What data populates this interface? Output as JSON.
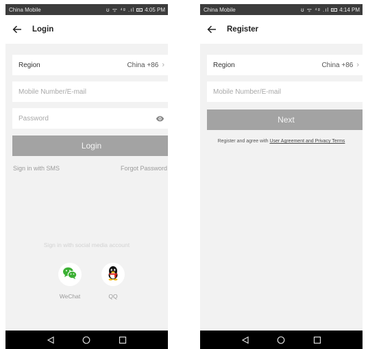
{
  "login": {
    "status": {
      "carrier": "China Mobile",
      "icons": "ʊ ᯤ ⁴ᵍ .ıl",
      "time": "4:05 PM"
    },
    "title": "Login",
    "region": {
      "label": "Region",
      "value": "China +86"
    },
    "account_placeholder": "Mobile Number/E-mail",
    "password_placeholder": "Password",
    "login_button": "Login",
    "sms_link": "Sign in with SMS",
    "forgot_link": "Forgot Password",
    "social": {
      "title": "Sign in with social media account",
      "wechat_label": "WeChat",
      "qq_label": "QQ"
    }
  },
  "register": {
    "status": {
      "carrier": "China Mobile",
      "icons": "ʊ ᯤ ⁴ᵍ .ıl",
      "time": "4:14 PM"
    },
    "title": "Register",
    "region": {
      "label": "Region",
      "value": "China +86"
    },
    "account_placeholder": "Mobile Number/E-mail",
    "next_button": "Next",
    "terms_prefix": "Register and agree with ",
    "terms_link": "User Agreement and Privacy Terms"
  },
  "colors": {
    "button_disabled": "#a3a3a3",
    "background": "#f2f2f2",
    "wechat": "#3cb034",
    "nav_bar": "#000000"
  },
  "icons": {
    "back": "arrow-left-icon",
    "chevron": "chevron-right-icon",
    "eye": "eye-icon",
    "wechat": "wechat-icon",
    "qq": "qq-penguin-icon",
    "nav": [
      "nav-back-icon",
      "nav-home-icon",
      "nav-recents-icon"
    ]
  }
}
